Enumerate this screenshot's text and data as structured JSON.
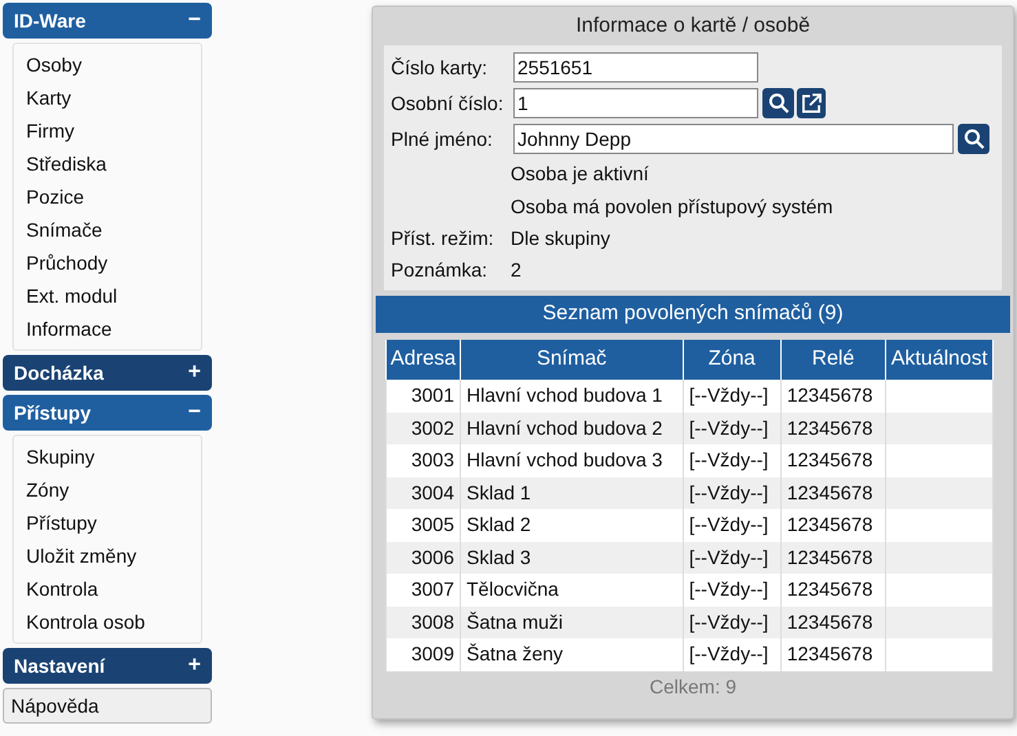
{
  "sidebar": {
    "sections": [
      {
        "title": "ID-Ware",
        "toggle": "−",
        "expanded": true,
        "items": [
          "Osoby",
          "Karty",
          "Firmy",
          "Střediska",
          "Pozice",
          "Snímače",
          "Průchody",
          "Ext. modul",
          "Informace"
        ]
      },
      {
        "title": "Docházka",
        "toggle": "+",
        "expanded": false
      },
      {
        "title": "Přístupy",
        "toggle": "−",
        "expanded": true,
        "items": [
          "Skupiny",
          "Zóny",
          "Přístupy",
          "Uložit změny",
          "Kontrola",
          "Kontrola osob"
        ]
      },
      {
        "title": "Nastavení",
        "toggle": "+",
        "expanded": false
      }
    ],
    "help": "Nápověda"
  },
  "panel": {
    "title": "Informace o kartě / osobě",
    "fields": [
      {
        "label": "Číslo karty:",
        "value": "2551651"
      },
      {
        "label": "Osobní číslo:",
        "value": "1",
        "buttons": [
          {
            "kind": "search"
          },
          {
            "kind": "open"
          }
        ]
      },
      {
        "label": "Plné jméno:",
        "value": "Johnny Depp",
        "buttons": [
          {
            "kind": "search"
          }
        ],
        "wide": true
      }
    ],
    "notes": [
      "Osoba je aktivní",
      "Osoba má povolen přístupový systém"
    ],
    "info": [
      {
        "label": "Příst. režim:",
        "value": "Dle skupiny"
      },
      {
        "label": "Poznámka:",
        "value": "2"
      }
    ],
    "list_title": "Seznam povolených snímačů (9)",
    "table": {
      "columns": [
        "Adresa",
        "Snímač",
        "Zóna",
        "Relé",
        "Aktuálnost"
      ],
      "rows": [
        [
          "3001",
          "Hlavní vchod budova 1",
          "[--Vždy--]",
          "12345678"
        ],
        [
          "3002",
          "Hlavní vchod budova 2",
          "[--Vždy--]",
          "12345678"
        ],
        [
          "3003",
          "Hlavní vchod budova 3",
          "[--Vždy--]",
          "12345678"
        ],
        [
          "3004",
          "Sklad 1",
          "[--Vždy--]",
          "12345678"
        ],
        [
          "3005",
          "Sklad 2",
          "[--Vždy--]",
          "12345678"
        ],
        [
          "3006",
          "Sklad 3",
          "[--Vždy--]",
          "12345678"
        ],
        [
          "3007",
          "Tělocvična",
          "[--Vždy--]",
          "12345678"
        ],
        [
          "3008",
          "Šatna muži",
          "[--Vždy--]",
          "12345678"
        ],
        [
          "3009",
          "Šatna ženy",
          "[--Vždy--]",
          "12345678"
        ]
      ]
    },
    "total": "Celkem: 9"
  }
}
